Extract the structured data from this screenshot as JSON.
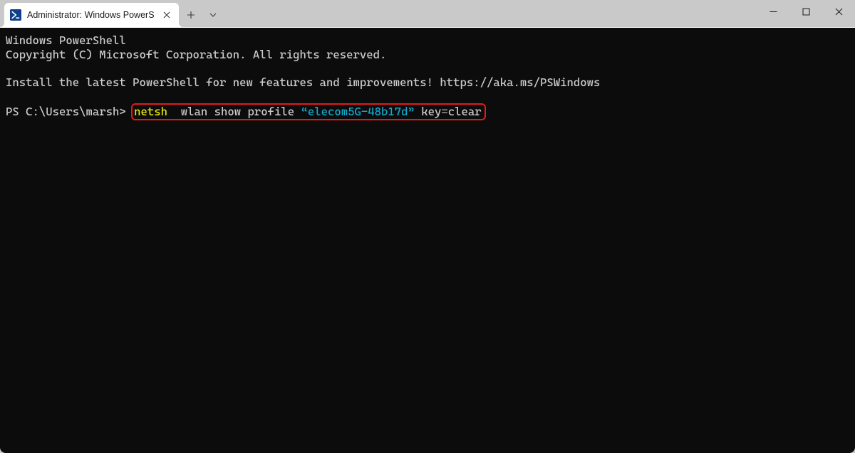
{
  "tab": {
    "title": "Administrator: Windows PowerS"
  },
  "terminal": {
    "line1": "Windows PowerShell",
    "line2": "Copyright (C) Microsoft Corporation. All rights reserved.",
    "line3": "Install the latest PowerShell for new features and improvements! https://aka.ms/PSWindows",
    "prompt": "PS C:\\Users\\marsh> ",
    "cmd": {
      "p1": "netsh",
      "p2": "  wlan show profile ",
      "p3": "“elecom5G-48b17d”",
      "p4": " key",
      "p5": "=",
      "p6": "clear"
    }
  }
}
